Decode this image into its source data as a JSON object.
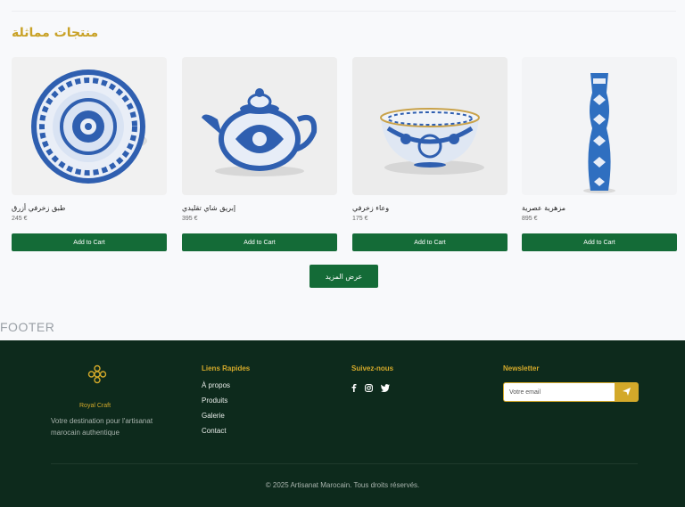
{
  "section": {
    "title": "منتجات مماثلة"
  },
  "products": [
    {
      "name": "طبق زخرفي أزرق",
      "price": "245 €",
      "button": "Add to Cart",
      "image_icon": "blue-plate-image"
    },
    {
      "name": "إبريق شاي تقليدي",
      "price": "395 €",
      "button": "Add to Cart",
      "image_icon": "teapot-image"
    },
    {
      "name": "وعاء زخرفي",
      "price": "175 €",
      "button": "Add to Cart",
      "image_icon": "bowl-image"
    },
    {
      "name": "مزهرية عصرية",
      "price": "895 €",
      "button": "Add to Cart",
      "image_icon": "vase-image"
    }
  ],
  "more_button": "عرض المزيد",
  "footer_tag": "FOOTER",
  "footer": {
    "brand_name": "Royal Craft",
    "description": "Votre destination pour l'artisanat marocain authentique",
    "quick_links": {
      "title": "Liens Rapides",
      "items": [
        "À propos",
        "Produits",
        "Galerie",
        "Contact"
      ]
    },
    "follow": {
      "title": "Suivez-nous",
      "icons": [
        "facebook-icon",
        "instagram-icon",
        "twitter-icon"
      ]
    },
    "newsletter": {
      "title": "Newsletter",
      "placeholder": "Votre email",
      "icon": "send-icon"
    },
    "copyright": "© 2025 Artisanat Marocain. Tous droits réservés."
  },
  "colors": {
    "accent_gold": "#d3a92a",
    "button_green": "#146b37",
    "footer_bg": "#0d2a1c"
  }
}
